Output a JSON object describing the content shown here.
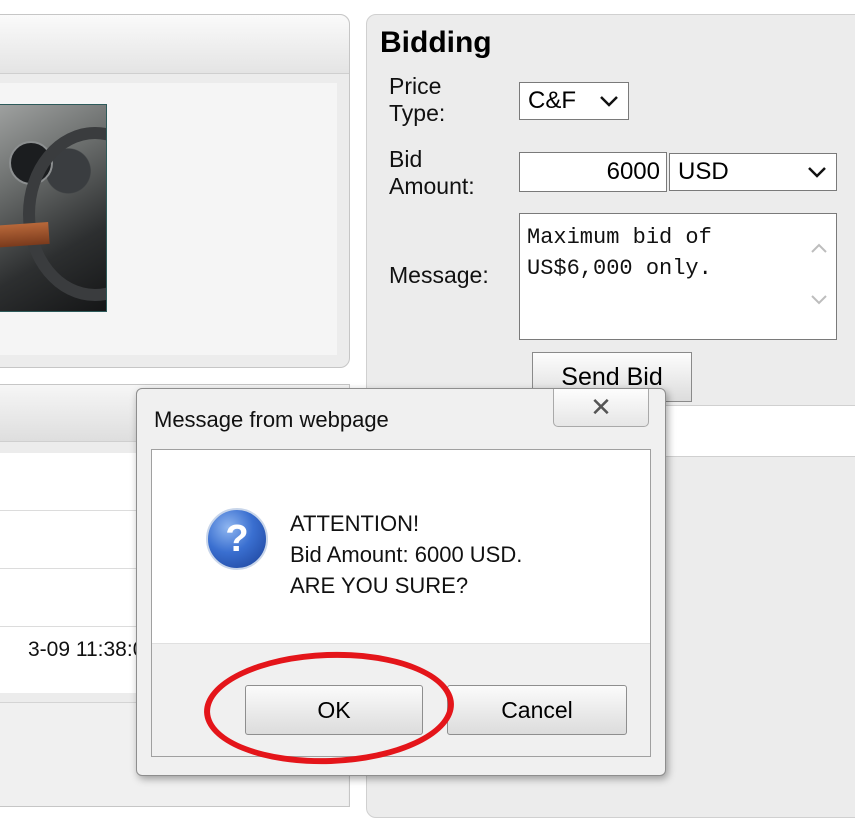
{
  "bidding": {
    "title": "Bidding",
    "price_type_label_line1": "Price",
    "price_type_label_line2": "Type:",
    "price_type_value": "C&F",
    "bid_amount_label_line1": "Bid",
    "bid_amount_label_line2": "Amount:",
    "bid_amount_value": "6000",
    "currency_value": "USD",
    "message_label": "Message:",
    "message_line1": "Maximum bid of",
    "message_line2": "US$6,000 only.",
    "send_button": "Send Bid"
  },
  "background": {
    "timestamp_fragment": "3-09 11:38:0"
  },
  "dialog": {
    "title": "Message from webpage",
    "close_glyph": "✕",
    "icon_glyph": "?",
    "line1": "ATTENTION!",
    "line2": "Bid Amount: 6000 USD.",
    "line3": "ARE YOU SURE?",
    "ok_label": "OK",
    "cancel_label": "Cancel"
  },
  "annotation": {
    "highlight_color": "#e4151a",
    "highlight_target": "ok-button"
  },
  "icons": {
    "dropdown": "chevron-down-icon",
    "question": "question-icon",
    "close": "close-icon"
  }
}
